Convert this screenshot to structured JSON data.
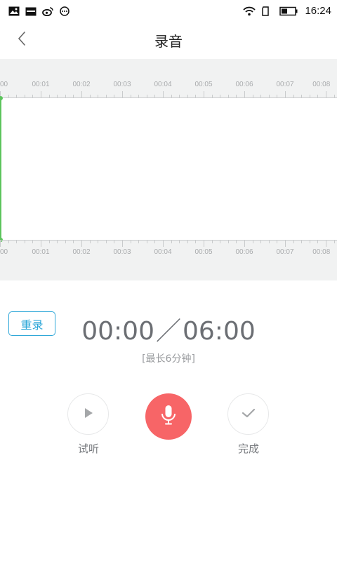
{
  "status_bar": {
    "time": "16:24",
    "left_icons": [
      "image-icon",
      "calendar-icon",
      "weibo-icon",
      "more-dots-icon"
    ],
    "right_icons": [
      "wifi-icon",
      "sim-icon",
      "battery-icon"
    ]
  },
  "header": {
    "title": "录音",
    "back_icon": "chevron-left-icon"
  },
  "ruler": {
    "ticks": [
      "00",
      "00:01",
      "00:02",
      "00:03",
      "00:04",
      "00:05",
      "00:06",
      "00:07",
      "00:08"
    ]
  },
  "waveform": {
    "playhead_color": "#5cc45c"
  },
  "controls": {
    "rerecord_label": "重录",
    "timer_current": "00:00",
    "timer_separator": "／",
    "timer_max": "06:00",
    "limit_note": "[最长6分钟]",
    "play_label": "试听",
    "done_label": "完成",
    "record_color": "#f76567",
    "accent_color": "#2ea7d8"
  }
}
